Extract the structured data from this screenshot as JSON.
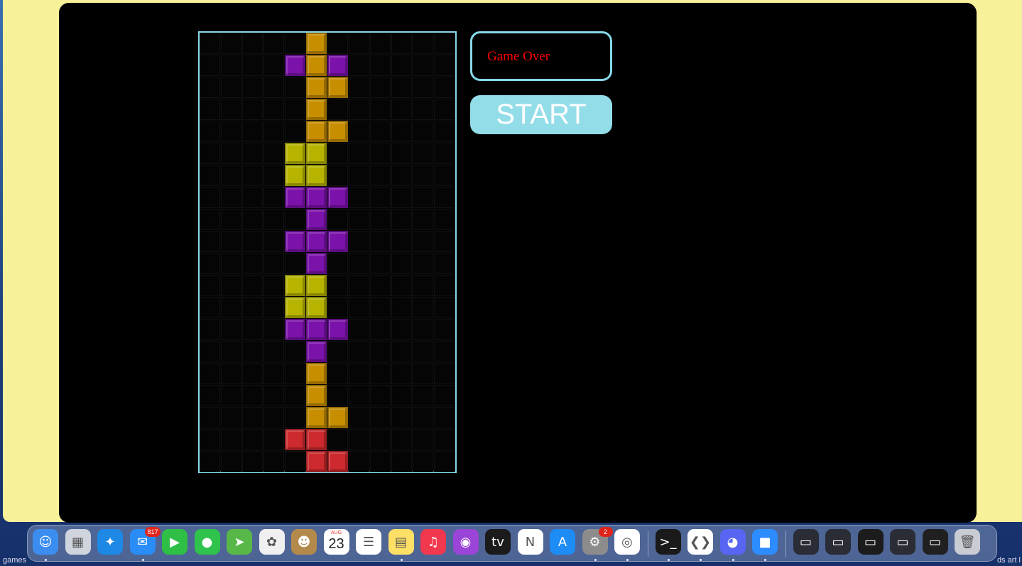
{
  "game": {
    "status_text": "Game Over",
    "start_label": "START",
    "board": {
      "columns": 12,
      "rows": 20,
      "piece_colors": {
        "orange": "#c78e00",
        "purple": "#7b12aa",
        "yellow": "#b7b400",
        "red": "#cc2a2e"
      },
      "filled_cells": [
        {
          "col": 5,
          "row": 0,
          "color": "orange"
        },
        {
          "col": 4,
          "row": 1,
          "color": "purple"
        },
        {
          "col": 5,
          "row": 1,
          "color": "orange"
        },
        {
          "col": 6,
          "row": 1,
          "color": "purple"
        },
        {
          "col": 5,
          "row": 2,
          "color": "orange"
        },
        {
          "col": 6,
          "row": 2,
          "color": "orange"
        },
        {
          "col": 5,
          "row": 3,
          "color": "orange"
        },
        {
          "col": 5,
          "row": 4,
          "color": "orange"
        },
        {
          "col": 6,
          "row": 4,
          "color": "orange"
        },
        {
          "col": 4,
          "row": 5,
          "color": "yellow"
        },
        {
          "col": 5,
          "row": 5,
          "color": "yellow"
        },
        {
          "col": 4,
          "row": 6,
          "color": "yellow"
        },
        {
          "col": 5,
          "row": 6,
          "color": "yellow"
        },
        {
          "col": 4,
          "row": 7,
          "color": "purple"
        },
        {
          "col": 5,
          "row": 7,
          "color": "purple"
        },
        {
          "col": 6,
          "row": 7,
          "color": "purple"
        },
        {
          "col": 5,
          "row": 8,
          "color": "purple"
        },
        {
          "col": 4,
          "row": 9,
          "color": "purple"
        },
        {
          "col": 5,
          "row": 9,
          "color": "purple"
        },
        {
          "col": 6,
          "row": 9,
          "color": "purple"
        },
        {
          "col": 5,
          "row": 10,
          "color": "purple"
        },
        {
          "col": 4,
          "row": 11,
          "color": "yellow"
        },
        {
          "col": 5,
          "row": 11,
          "color": "yellow"
        },
        {
          "col": 4,
          "row": 12,
          "color": "yellow"
        },
        {
          "col": 5,
          "row": 12,
          "color": "yellow"
        },
        {
          "col": 4,
          "row": 13,
          "color": "purple"
        },
        {
          "col": 5,
          "row": 13,
          "color": "purple"
        },
        {
          "col": 6,
          "row": 13,
          "color": "purple"
        },
        {
          "col": 5,
          "row": 14,
          "color": "purple"
        },
        {
          "col": 5,
          "row": 15,
          "color": "orange"
        },
        {
          "col": 5,
          "row": 16,
          "color": "orange"
        },
        {
          "col": 5,
          "row": 17,
          "color": "orange"
        },
        {
          "col": 6,
          "row": 17,
          "color": "orange"
        },
        {
          "col": 4,
          "row": 18,
          "color": "red"
        },
        {
          "col": 5,
          "row": 18,
          "color": "red"
        },
        {
          "col": 5,
          "row": 19,
          "color": "red"
        },
        {
          "col": 6,
          "row": 19,
          "color": "red"
        }
      ]
    }
  },
  "status_bar": {
    "left_text": "games",
    "right_text": "ds art l"
  },
  "dock": {
    "items": [
      {
        "name": "finder-icon",
        "bg": "#3b8ef0",
        "glyph": "☺",
        "dot": true
      },
      {
        "name": "launchpad-icon",
        "bg": "#d0d4dc",
        "glyph": "▦",
        "dot": false
      },
      {
        "name": "safari-icon",
        "bg": "#1e88e5",
        "glyph": "✦",
        "dot": false
      },
      {
        "name": "mail-icon",
        "bg": "#2a8cf7",
        "glyph": "✉",
        "dot": true,
        "badge": "817"
      },
      {
        "name": "facetime-icon",
        "bg": "#2fbe46",
        "glyph": "▶",
        "dot": false
      },
      {
        "name": "messages-icon",
        "bg": "#2fc24d",
        "glyph": "●",
        "dot": false
      },
      {
        "name": "maps-icon",
        "bg": "#58b847",
        "glyph": "➤",
        "dot": false
      },
      {
        "name": "photos-icon",
        "bg": "#f0f0f0",
        "glyph": "✿",
        "dot": false
      },
      {
        "name": "contacts-icon",
        "bg": "#b48a4c",
        "glyph": "☻",
        "dot": false
      },
      {
        "name": "calendar-icon",
        "bg": "#ffffff",
        "glyph": "",
        "dot": false,
        "calendar_month": "AUG",
        "calendar_day": "23"
      },
      {
        "name": "reminders-icon",
        "bg": "#ffffff",
        "glyph": "☰",
        "dot": false
      },
      {
        "name": "notes-icon",
        "bg": "#ffe066",
        "glyph": "▤",
        "dot": true
      },
      {
        "name": "music-icon",
        "bg": "#f2384e",
        "glyph": "♫",
        "dot": false
      },
      {
        "name": "podcasts-icon",
        "bg": "#9b44d8",
        "glyph": "◉",
        "dot": false
      },
      {
        "name": "apple-tv-icon",
        "bg": "#1b1b1b",
        "glyph": "tv",
        "dot": false
      },
      {
        "name": "news-icon",
        "bg": "#ffffff",
        "glyph": "N",
        "dot": false
      },
      {
        "name": "app-store-icon",
        "bg": "#1e8cf5",
        "glyph": "A",
        "dot": false
      },
      {
        "name": "system-settings-icon",
        "bg": "#8c8c8c",
        "glyph": "⚙",
        "dot": true,
        "badge": "2"
      },
      {
        "name": "chrome-icon",
        "bg": "#ffffff",
        "glyph": "◎",
        "dot": true
      },
      {
        "name": "terminal-icon",
        "bg": "#1a1a1a",
        "glyph": ">_",
        "dot": true
      },
      {
        "name": "vscode-icon",
        "bg": "#ffffff",
        "glyph": "❮❯",
        "dot": true
      },
      {
        "name": "discord-icon",
        "bg": "#5865f2",
        "glyph": "◕",
        "dot": true
      },
      {
        "name": "zoom-icon",
        "bg": "#2d8cff",
        "glyph": "■",
        "dot": true
      },
      {
        "name": "window-thumb-1-icon",
        "bg": "#2a2d35",
        "glyph": "▭",
        "dot": false
      },
      {
        "name": "window-thumb-2-icon",
        "bg": "#2a2d35",
        "glyph": "▭",
        "dot": false
      },
      {
        "name": "window-thumb-3-icon",
        "bg": "#1c1c1c",
        "glyph": "▭",
        "dot": false
      },
      {
        "name": "window-thumb-4-icon",
        "bg": "#2a2d35",
        "glyph": "▭",
        "dot": false
      },
      {
        "name": "window-thumb-5-icon",
        "bg": "#202020",
        "glyph": "▭",
        "dot": false
      },
      {
        "name": "trash-icon",
        "bg": "#c9ccd3",
        "glyph": "🗑",
        "dot": false
      }
    ]
  }
}
